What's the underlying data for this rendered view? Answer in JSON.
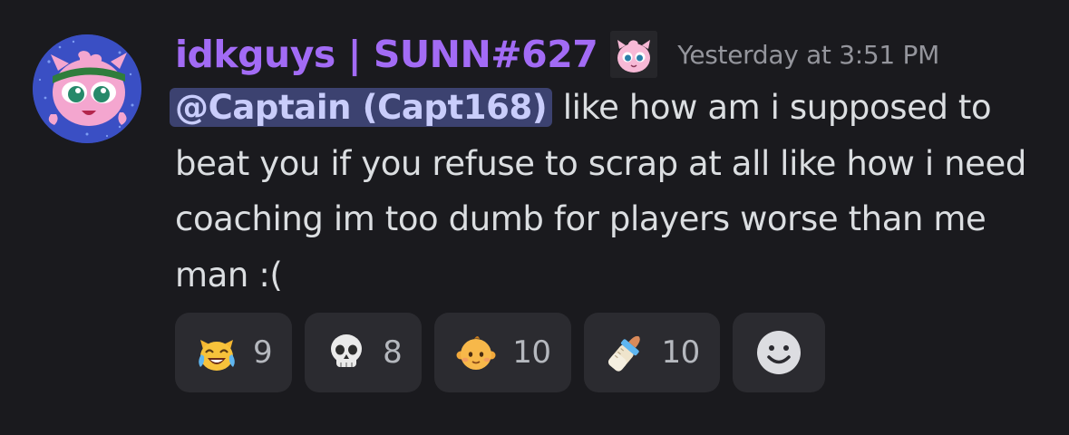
{
  "message": {
    "avatar_icon": "jigglypuff-avatar",
    "username": "idkguys | SUNN#627",
    "username_color": "#a26bf5",
    "role_icon": "jigglypuff-role-icon",
    "timestamp": "Yesterday at 3:51 PM",
    "mention": "@Captain (Capt168)",
    "text": " like how am i supposed to beat you if you refuse to scrap at all like how i need coaching im too dumb for players worse than me man :("
  },
  "reactions": [
    {
      "icon": "joy-cat-emoji",
      "count": "9"
    },
    {
      "icon": "skull-emoji",
      "count": "8"
    },
    {
      "icon": "baby-emoji",
      "count": "10"
    },
    {
      "icon": "baby-bottle-emoji",
      "count": "10"
    }
  ],
  "add_reaction_icon": "add-reaction-smiley-icon"
}
